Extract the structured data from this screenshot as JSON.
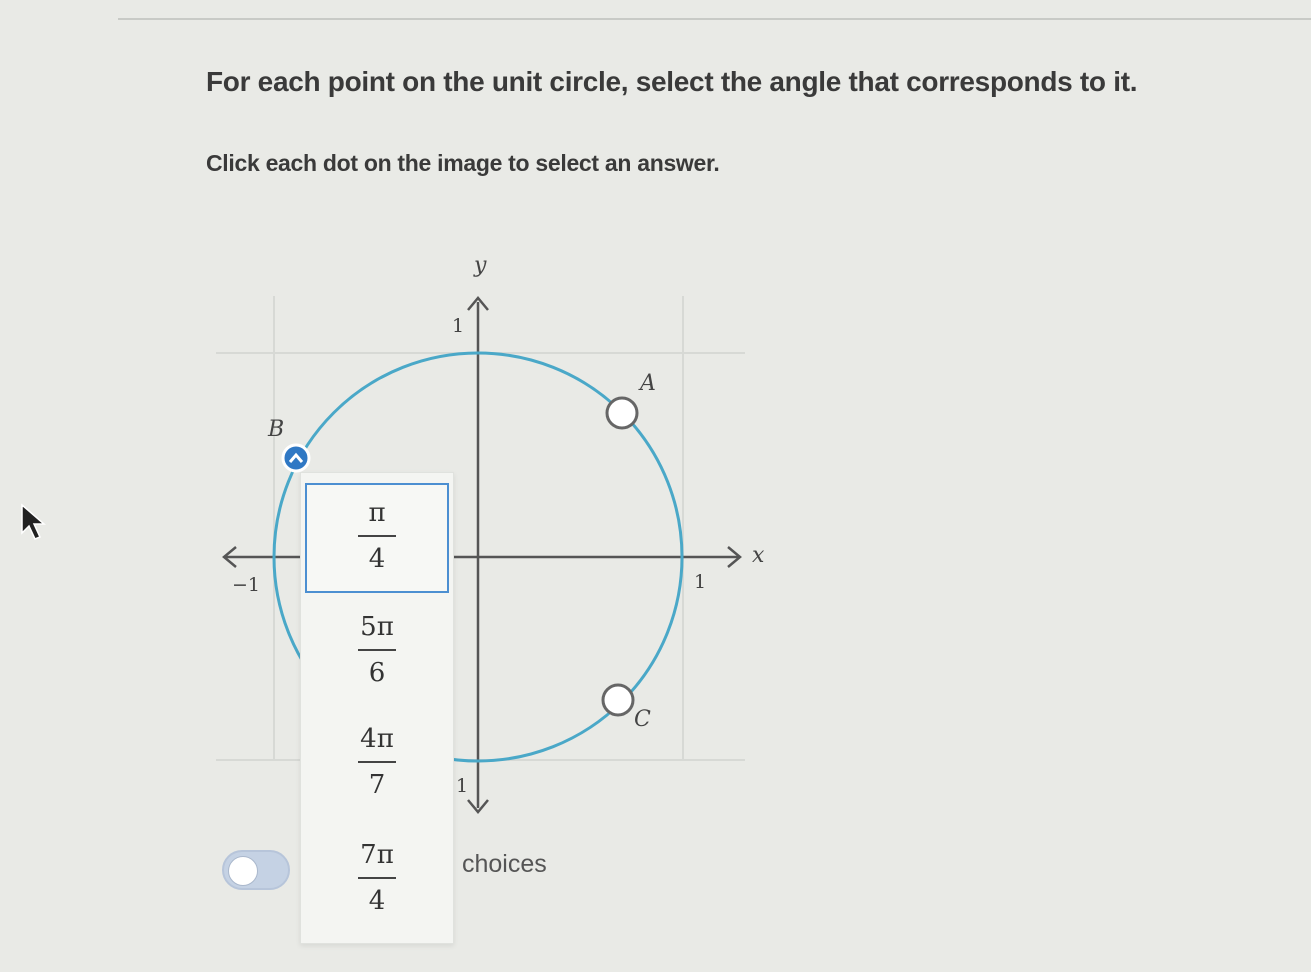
{
  "prompt": "For each point on the unit circle, select the angle that corresponds to it.",
  "instructions": "Click each dot on the image to select an answer.",
  "graph": {
    "x_axis_label": "x",
    "y_axis_label": "y",
    "ticks": {
      "x_neg": "−1",
      "x_pos": "1",
      "y_pos": "1",
      "y_neg": "1"
    },
    "points": [
      {
        "label": "A"
      },
      {
        "label": "B"
      },
      {
        "label": "C"
      }
    ],
    "circle_color": "#4aa8c8",
    "active_point_color": "#2f78c4"
  },
  "dropdown": {
    "options": [
      {
        "numerator": "π",
        "denominator": "4"
      },
      {
        "numerator": "5π",
        "denominator": "6"
      },
      {
        "numerator": "4π",
        "denominator": "7"
      },
      {
        "numerator": "7π",
        "denominator": "4"
      }
    ],
    "selected_index": 0
  },
  "choices_label": "choices"
}
